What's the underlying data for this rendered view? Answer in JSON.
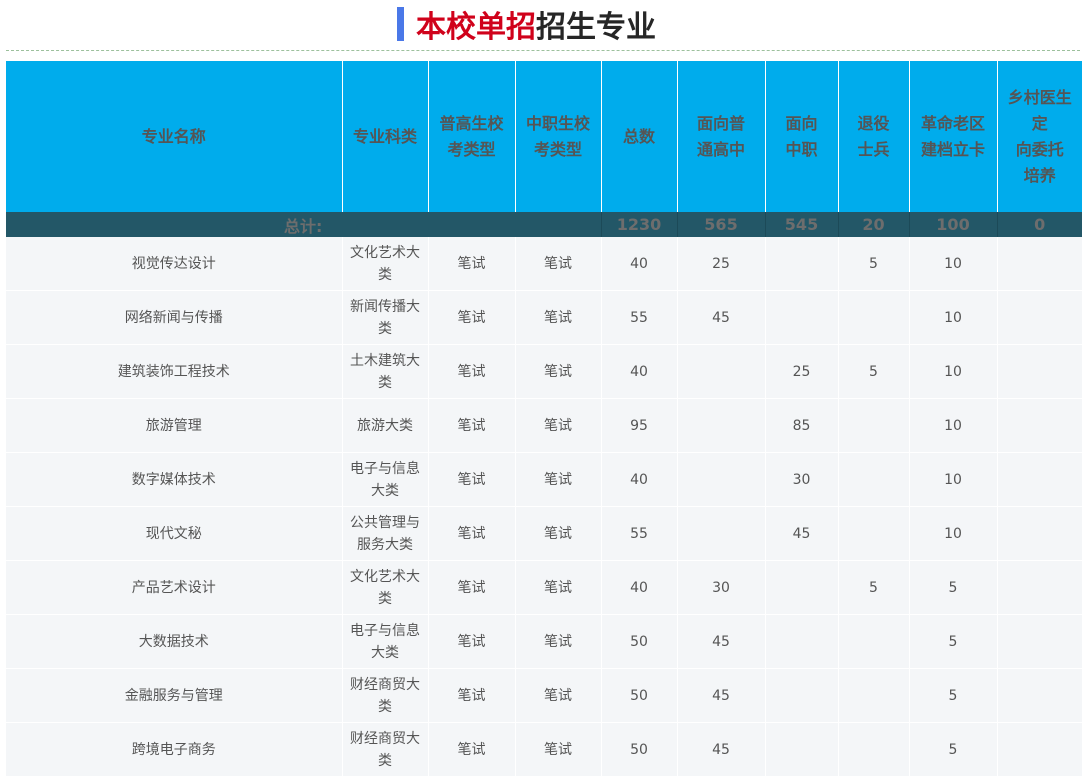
{
  "title": {
    "red": "本校单招",
    "dark": "招生专业"
  },
  "headers": [
    "专业名称",
    "专业科类",
    "普高生校考类型",
    "中职生校考类型",
    "总数",
    "面向普通高中",
    "面向中职",
    "退役士兵",
    "革命老区建档立卡",
    "乡村医生定向委托培养"
  ],
  "header_lines": [
    [
      "专业名称"
    ],
    [
      "专业科类"
    ],
    [
      "普高生校",
      "考类型"
    ],
    [
      "中职生校",
      "考类型"
    ],
    [
      "总数"
    ],
    [
      "面向普",
      "通高中"
    ],
    [
      "面向",
      "中职"
    ],
    [
      "退役",
      "士兵"
    ],
    [
      "革命老区",
      "建档立卡"
    ],
    [
      "乡村医生",
      "定",
      "向委托",
      "培养"
    ]
  ],
  "totals": {
    "label": "总计:",
    "total": "1230",
    "general": "565",
    "vocational": "545",
    "veterans": "20",
    "revolution": "100",
    "village": "0"
  },
  "rows": [
    {
      "name": "视觉传达设计",
      "category": [
        "文化艺术大",
        "类"
      ],
      "general_exam": "笔试",
      "vocational_exam": "笔试",
      "total": "40",
      "general": "25",
      "vocational": "",
      "veterans": "5",
      "revolution": "10",
      "village": ""
    },
    {
      "name": "网络新闻与传播",
      "category": [
        "新闻传播大",
        "类"
      ],
      "general_exam": "笔试",
      "vocational_exam": "笔试",
      "total": "55",
      "general": "45",
      "vocational": "",
      "veterans": "",
      "revolution": "10",
      "village": ""
    },
    {
      "name": "建筑装饰工程技术",
      "category": [
        "土木建筑大",
        "类"
      ],
      "general_exam": "笔试",
      "vocational_exam": "笔试",
      "total": "40",
      "general": "",
      "vocational": "25",
      "veterans": "5",
      "revolution": "10",
      "village": ""
    },
    {
      "name": "旅游管理",
      "category": [
        "旅游大类"
      ],
      "general_exam": "笔试",
      "vocational_exam": "笔试",
      "total": "95",
      "general": "",
      "vocational": "85",
      "veterans": "",
      "revolution": "10",
      "village": ""
    },
    {
      "name": "数字媒体技术",
      "category": [
        "电子与信息",
        "大类"
      ],
      "general_exam": "笔试",
      "vocational_exam": "笔试",
      "total": "40",
      "general": "",
      "vocational": "30",
      "veterans": "",
      "revolution": "10",
      "village": ""
    },
    {
      "name": "现代文秘",
      "category": [
        "公共管理与",
        "服务大类"
      ],
      "general_exam": "笔试",
      "vocational_exam": "笔试",
      "total": "55",
      "general": "",
      "vocational": "45",
      "veterans": "",
      "revolution": "10",
      "village": ""
    },
    {
      "name": "产品艺术设计",
      "category": [
        "文化艺术大",
        "类"
      ],
      "general_exam": "笔试",
      "vocational_exam": "笔试",
      "total": "40",
      "general": "30",
      "vocational": "",
      "veterans": "5",
      "revolution": "5",
      "village": ""
    },
    {
      "name": "大数据技术",
      "category": [
        "电子与信息",
        "大类"
      ],
      "general_exam": "笔试",
      "vocational_exam": "笔试",
      "total": "50",
      "general": "45",
      "vocational": "",
      "veterans": "",
      "revolution": "5",
      "village": ""
    },
    {
      "name": "金融服务与管理",
      "category": [
        "财经商贸大",
        "类"
      ],
      "general_exam": "笔试",
      "vocational_exam": "笔试",
      "total": "50",
      "general": "45",
      "vocational": "",
      "veterans": "",
      "revolution": "5",
      "village": ""
    },
    {
      "name": "跨境电子商务",
      "category": [
        "财经商贸大",
        "类"
      ],
      "general_exam": "笔试",
      "vocational_exam": "笔试",
      "total": "50",
      "general": "45",
      "vocational": "",
      "veterans": "",
      "revolution": "5",
      "village": ""
    }
  ],
  "colors": {
    "header_bg": "#00acec",
    "total_bg": "#235767",
    "title_red": "#d0021b",
    "title_bar": "#4a78e8"
  }
}
